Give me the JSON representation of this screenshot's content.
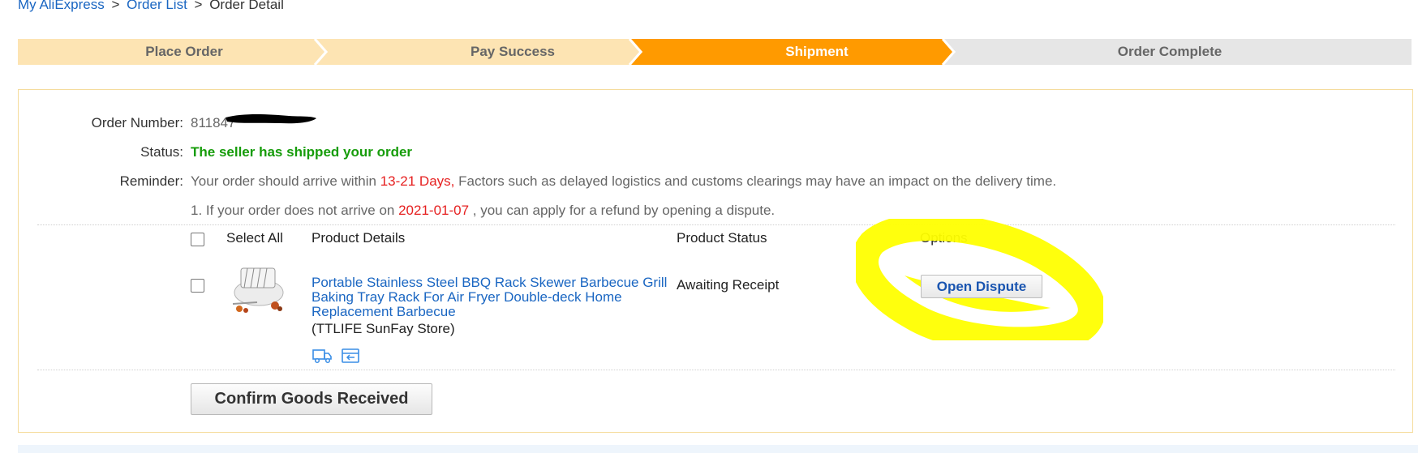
{
  "breadcrumb": {
    "item1": "My AliExpress",
    "sep": ">",
    "item2": "Order List",
    "item3": "Order Detail"
  },
  "steps": [
    {
      "label": "Place Order",
      "state": "done"
    },
    {
      "label": "Pay Success",
      "state": "done"
    },
    {
      "label": "Shipment",
      "state": "active"
    },
    {
      "label": "Order Complete",
      "state": "pending"
    }
  ],
  "order": {
    "number_label": "Order Number:",
    "number_value": "811847",
    "status_label": "Status:",
    "status_value": "The seller has shipped your order",
    "reminder_label": "Reminder:",
    "reminder_pre": "Your order should arrive within ",
    "reminder_days": "13-21 Days,",
    "reminder_post": " Factors such as delayed logistics and customs clearings may have an impact on the delivery time.",
    "refund_pre": "1. If your order does not arrive on ",
    "refund_date": "2021-01-07",
    "refund_post": " , you can apply for a refund by opening a dispute."
  },
  "table": {
    "select_all": "Select All",
    "col_product": "Product Details",
    "col_status": "Product Status",
    "col_options": "Options"
  },
  "item": {
    "title": "Portable Stainless Steel BBQ Rack Skewer Barbecue Grill Baking Tray Rack For Air Fryer Double-deck Home Replacement Barbecue",
    "store": "(TTLIFE SunFay Store)",
    "status": "Awaiting Receipt",
    "action": "Open Dispute",
    "icons": [
      "truck-icon",
      "return-icon"
    ]
  },
  "confirm_button": "Confirm Goods Received",
  "colors": {
    "step_done": "#fde4b3",
    "step_active": "#ff9a00",
    "step_pending": "#e6e6e6",
    "link": "#1a66c2",
    "status_green": "#169c0a",
    "alert_red": "#e62020",
    "highlight": "#ffff00"
  }
}
